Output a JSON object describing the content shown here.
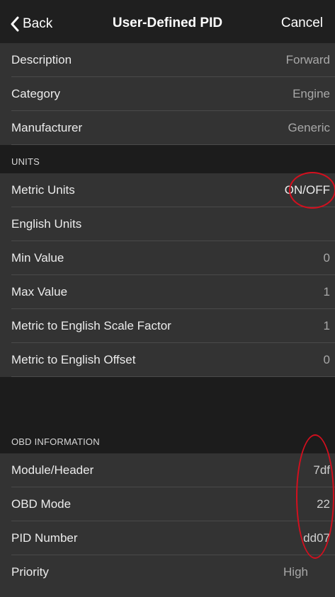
{
  "nav": {
    "back_label": "Back",
    "title": "User-Defined PID",
    "cancel_label": "Cancel"
  },
  "general": [
    {
      "label": "Description",
      "value": "Forward"
    },
    {
      "label": "Category",
      "value": "Engine"
    },
    {
      "label": "Manufacturer",
      "value": "Generic"
    }
  ],
  "units": {
    "header": "UNITS",
    "rows": [
      {
        "label": "Metric Units",
        "value": "ON/OFF"
      },
      {
        "label": "English Units",
        "value": ""
      },
      {
        "label": "Min Value",
        "value": "0"
      },
      {
        "label": "Max Value",
        "value": "1"
      },
      {
        "label": "Metric to English Scale Factor",
        "value": "1"
      },
      {
        "label": "Metric to English Offset",
        "value": "0"
      }
    ]
  },
  "obd": {
    "header": "OBD INFORMATION",
    "rows": [
      {
        "label": "Module/Header",
        "value": "7df"
      },
      {
        "label": "OBD Mode",
        "value": "22"
      },
      {
        "label": "PID Number",
        "value": "dd07"
      },
      {
        "label": "Priority",
        "value": "High"
      }
    ]
  },
  "colors": {
    "annotation": "#d40f1e",
    "row_background": "#333333",
    "screen_background": "#1c1c1c"
  }
}
